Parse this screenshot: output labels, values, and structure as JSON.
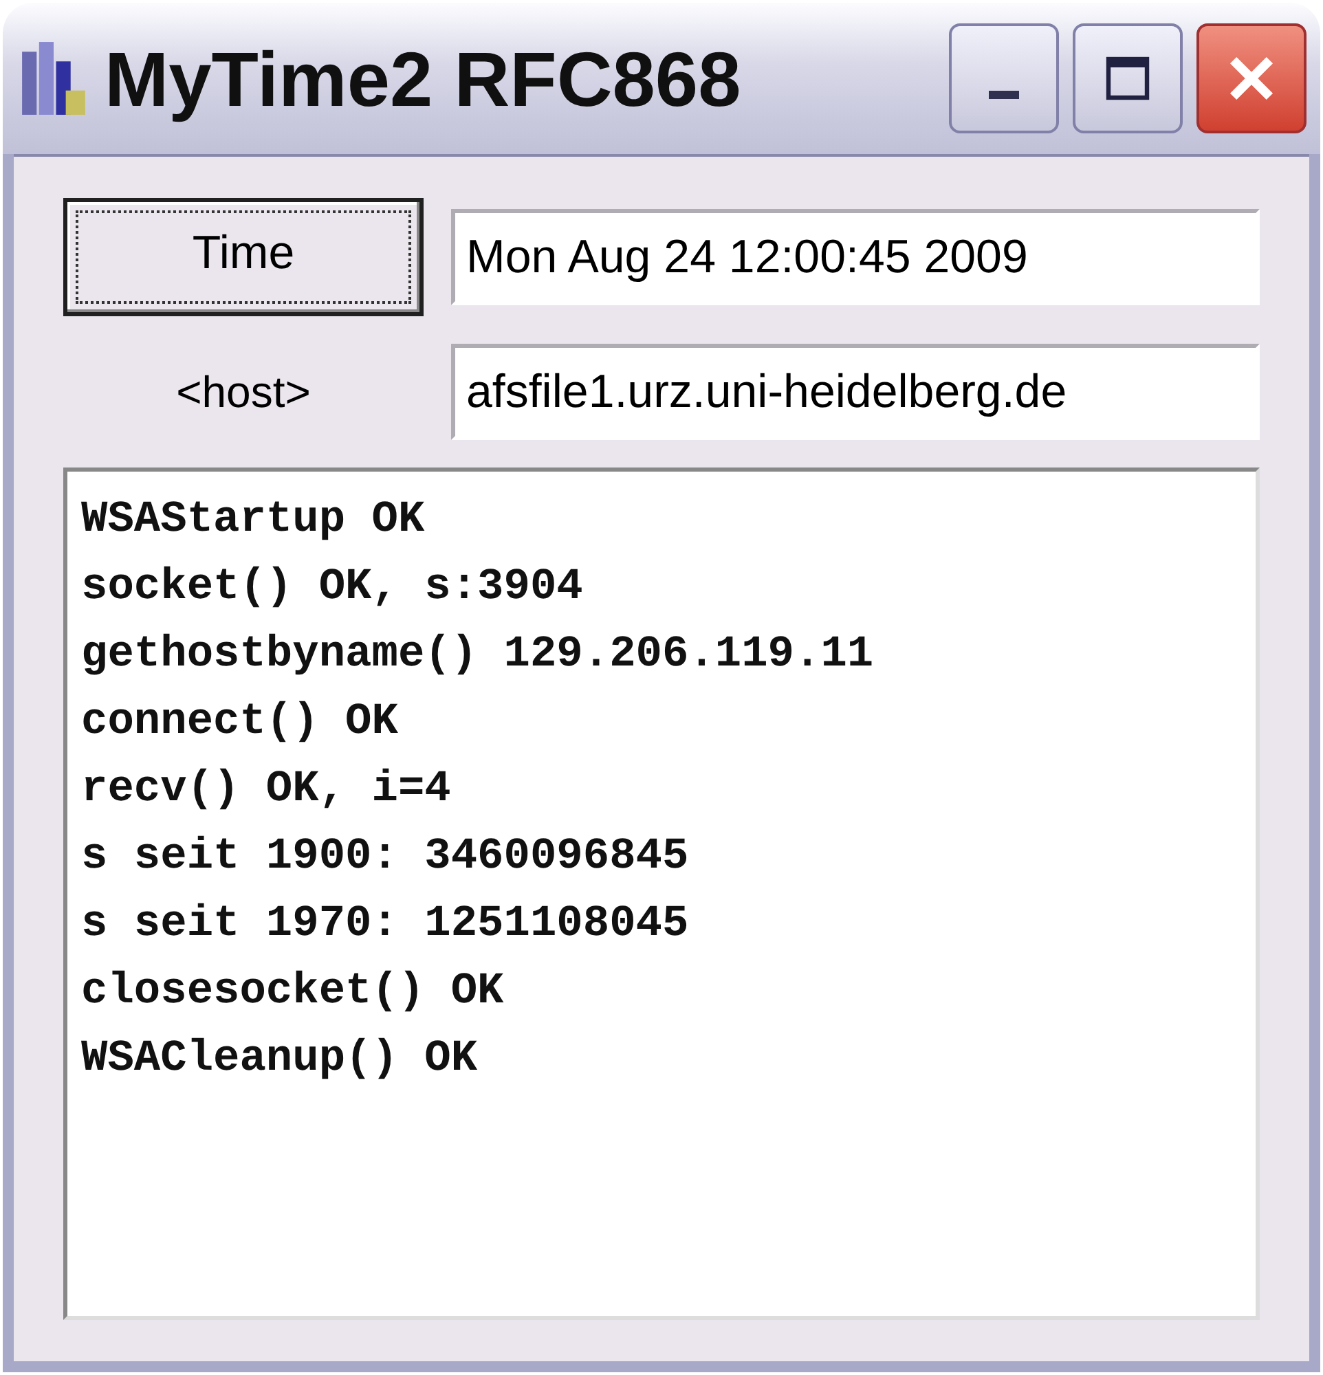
{
  "window": {
    "title": "MyTime2 RFC868"
  },
  "time_button": {
    "label": "Time"
  },
  "time_field": {
    "value": "Mon Aug 24 12:00:45 2009"
  },
  "host_label": "<host>",
  "host_field": {
    "value": "afsfile1.urz.uni-heidelberg.de"
  },
  "log": [
    "WSAStartup OK",
    "socket() OK, s:3904",
    "gethostbyname() 129.206.119.11",
    "connect() OK",
    "recv() OK, i=4",
    "s seit 1900: 3460096845",
    "s seit 1970: 1251108045",
    "closesocket() OK",
    "WSACleanup() OK"
  ]
}
